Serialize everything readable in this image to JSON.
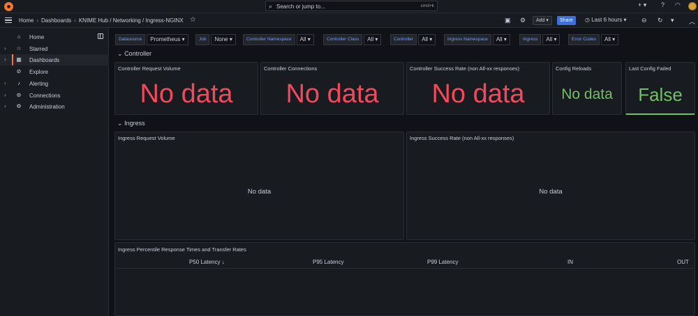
{
  "search": {
    "placeholder": "Search or jump to...",
    "shortcut": "cmd+k"
  },
  "breadcrumb": {
    "home": "Home",
    "dashboards": "Dashboards",
    "path": "KNIME Hub / Networking / Ingress-NGINX"
  },
  "toolbar": {
    "add_label": "Add",
    "share_label": "Share",
    "time_range": "Last 6 hours"
  },
  "sidebar": {
    "items": [
      {
        "label": "Home",
        "icon": "home-icon"
      },
      {
        "label": "Starred",
        "icon": "star-icon"
      },
      {
        "label": "Dashboards",
        "icon": "grid-icon"
      },
      {
        "label": "Explore",
        "icon": "compass-icon"
      },
      {
        "label": "Alerting",
        "icon": "bell-icon"
      },
      {
        "label": "Connections",
        "icon": "plug-icon"
      },
      {
        "label": "Administration",
        "icon": "gear-icon"
      }
    ]
  },
  "variables": [
    {
      "label": "Datasource",
      "value": "Prometheus"
    },
    {
      "label": "Job",
      "value": "None"
    },
    {
      "label": "Controller Namespace",
      "value": "All"
    },
    {
      "label": "Controller Class",
      "value": "All"
    },
    {
      "label": "Controller",
      "value": "All"
    },
    {
      "label": "Ingress Namespace",
      "value": "All"
    },
    {
      "label": "Ingress",
      "value": "All"
    },
    {
      "label": "Error Codes",
      "value": "All"
    }
  ],
  "rows": {
    "controller": "Controller",
    "ingress": "Ingress"
  },
  "panels": {
    "controller_request_volume": {
      "title": "Controller Request Volume",
      "value": "No data"
    },
    "controller_connections": {
      "title": "Controller Connections",
      "value": "No data"
    },
    "controller_success_rate": {
      "title": "Controller Success Rate (non All-xx responses)",
      "value": "No data"
    },
    "config_reloads": {
      "title": "Config Reloads",
      "value": "No data"
    },
    "last_config_failed": {
      "title": "Last Config Failed",
      "value": "False"
    },
    "ingress_request_volume": {
      "title": "Ingress Request Volume",
      "value": "No data"
    },
    "ingress_success_rate": {
      "title": "Ingress Success Rate (non All-xx responses)",
      "value": "No data"
    },
    "percentiles": {
      "title": "Ingress Percentile Response Times and Transfer Rates",
      "columns": [
        "P50 Latency",
        "P95 Latency",
        "P99 Latency",
        "IN",
        "OUT"
      ],
      "sort_indicator": "↓"
    }
  },
  "colors": {
    "red": "#f2495c",
    "green": "#73bf69",
    "accent": "#3d71d9"
  }
}
